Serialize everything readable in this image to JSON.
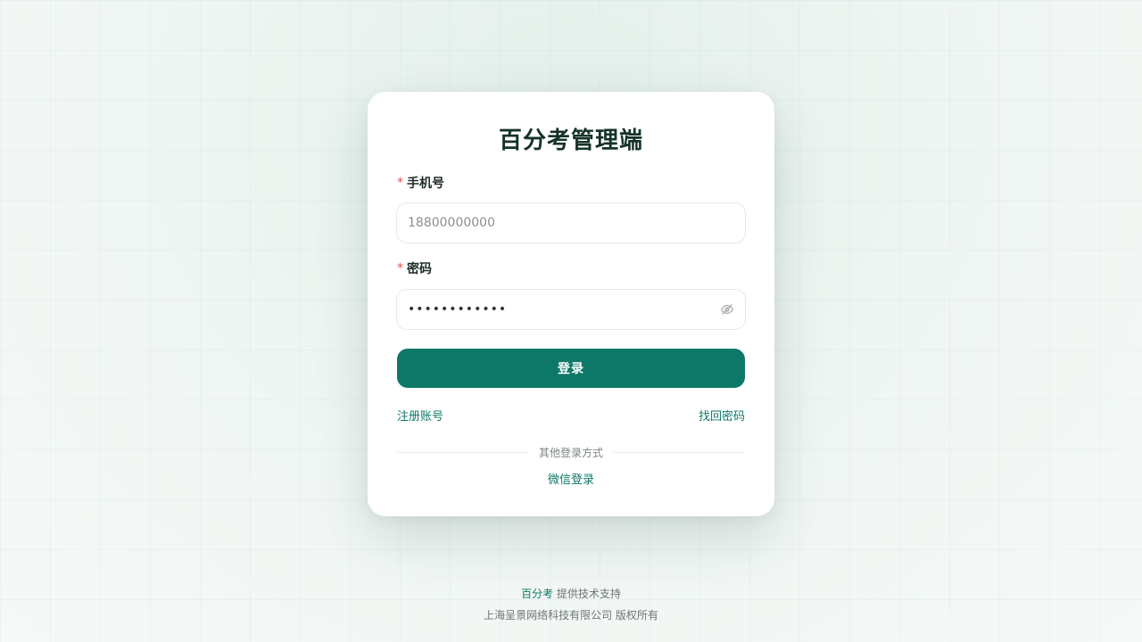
{
  "app": {
    "title": "百分考管理端"
  },
  "form": {
    "phone": {
      "label": "手机号",
      "required_mark": "*",
      "placeholder": "18800000000",
      "value": ""
    },
    "password": {
      "label": "密码",
      "required_mark": "*",
      "value": "••••••••••••"
    },
    "login_label": "登录",
    "register_label": "注册账号",
    "forgot_label": "找回密码",
    "other_methods_label": "其他登录方式",
    "wechat_label": "微信登录"
  },
  "footer": {
    "brand": "百分考",
    "support_text": "提供技术支持",
    "copyright": "上海呈景网络科技有限公司 版权所有"
  },
  "icons": {
    "password_toggle": "eye-off-icon"
  },
  "colors": {
    "primary": "#0e7868",
    "required": "#e0524d",
    "title": "#163328"
  }
}
